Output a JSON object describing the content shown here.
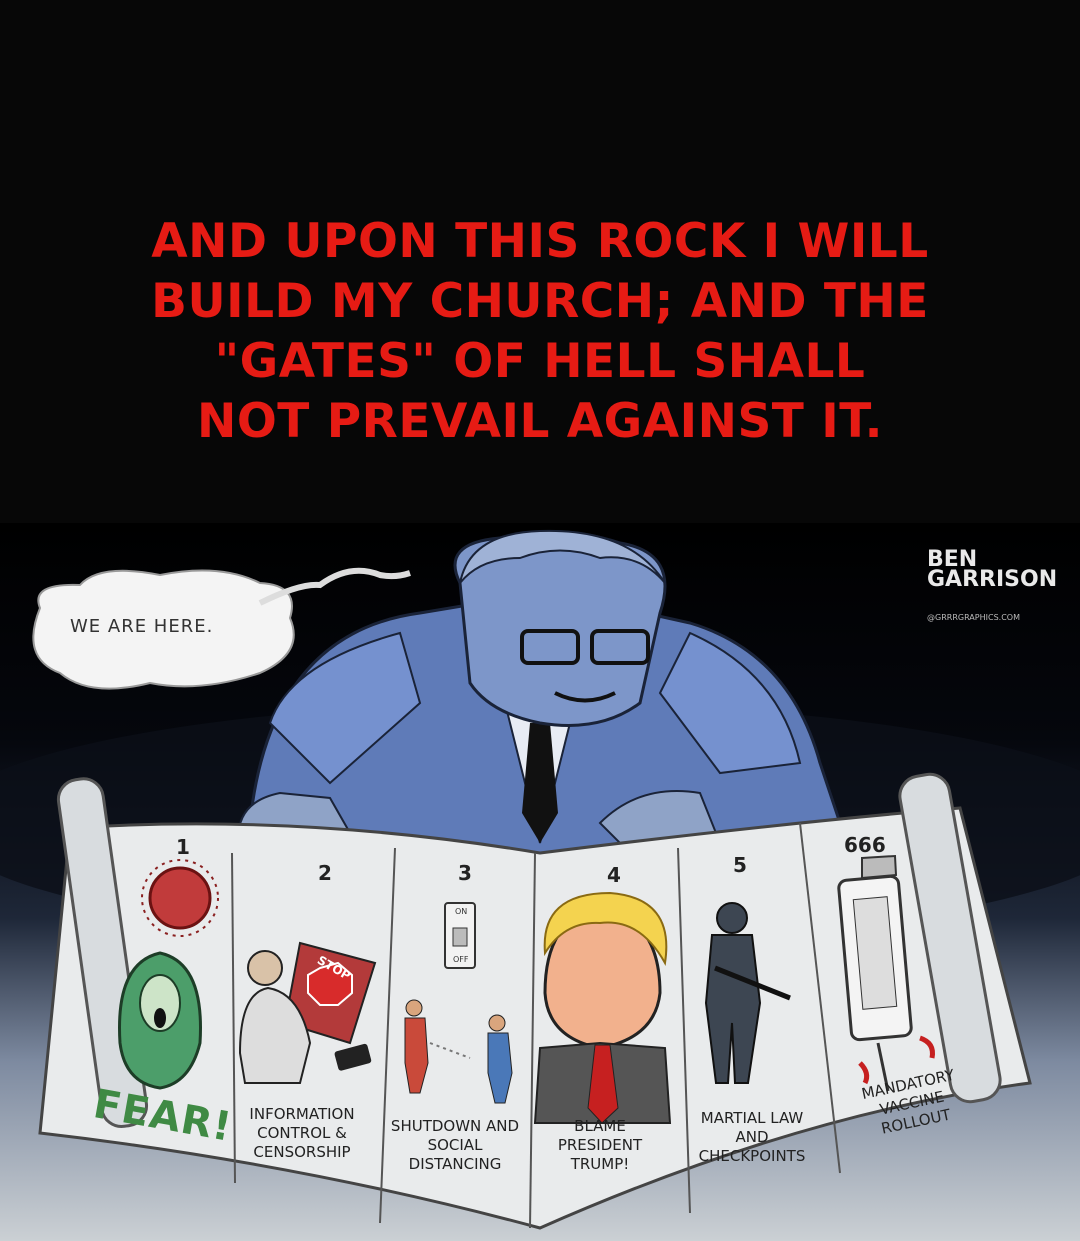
{
  "caption": {
    "lines": [
      "AND UPON THIS ROCK I WILL",
      "BUILD MY CHURCH; AND THE",
      "\"GATES\" OF HELL SHALL",
      "NOT PREVAIL AGAINST IT."
    ],
    "color": "#e61b14"
  },
  "cartoon": {
    "speech_bubble": "WE ARE HERE.",
    "signature": {
      "line1": "BEN",
      "line2": "GARRISON",
      "url": "@GRRRGRAPHICS.COM"
    },
    "panels": [
      {
        "number": "1",
        "label": "FEAR!"
      },
      {
        "number": "2",
        "label": "INFORMATION CONTROL & CENSORSHIP",
        "sign": "STOP"
      },
      {
        "number": "3",
        "label": "SHUTDOWN AND SOCIAL DISTANCING",
        "switch_on": "ON",
        "switch_off": "OFF"
      },
      {
        "number": "4",
        "label": "BLAME PRESIDENT TRUMP!"
      },
      {
        "number": "5",
        "label": "MARTIAL LAW AND CHECKPOINTS"
      },
      {
        "number": "666",
        "label": "MANDATORY VACCINE ROLLOUT"
      }
    ]
  }
}
